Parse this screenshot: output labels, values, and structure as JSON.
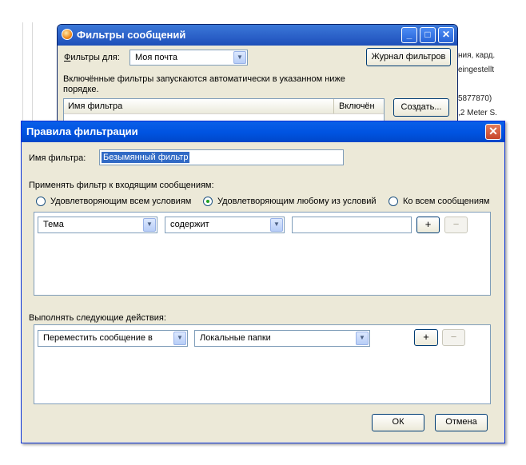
{
  "background": {
    "snippets": [
      "ния, кард.",
      "eingestellt",
      "5877870)",
      ",2 Meter S."
    ]
  },
  "filters_dialog": {
    "title": "Фильтры сообщений",
    "controls": {
      "minimize": "_",
      "maximize": "□",
      "close": "✕"
    },
    "filters_for_label": "Фильтры для:",
    "account_value": "Моя почта",
    "log_button": "Журнал фильтров",
    "description": "Включённые фильтры запускаются автоматически в указанном ниже порядке.",
    "columns": [
      "Имя фильтра",
      "Включён"
    ],
    "create_button": "Создать..."
  },
  "rules_dialog": {
    "title": "Правила фильтрации",
    "close": "✕",
    "filter_name_label": "Имя фильтра:",
    "filter_name_value": "Безымянный фильтр",
    "apply_label": "Применять фильтр к входящим сообщениям:",
    "match_options": [
      {
        "label": "Удовлетворяющим всем условиям",
        "selected": false
      },
      {
        "label": "Удовлетворяющим любому из условий",
        "selected": true
      },
      {
        "label": "Ко всем сообщениям",
        "selected": false
      }
    ],
    "condition": {
      "field": "Тема",
      "operator": "содержит",
      "value": "",
      "add": "+",
      "remove": "−"
    },
    "actions_label": "Выполнять следующие действия:",
    "action": {
      "type": "Переместить сообщение в",
      "target": "Локальные папки",
      "add": "+",
      "remove": "−"
    },
    "ok_button": "ОК",
    "cancel_button": "Отмена"
  }
}
